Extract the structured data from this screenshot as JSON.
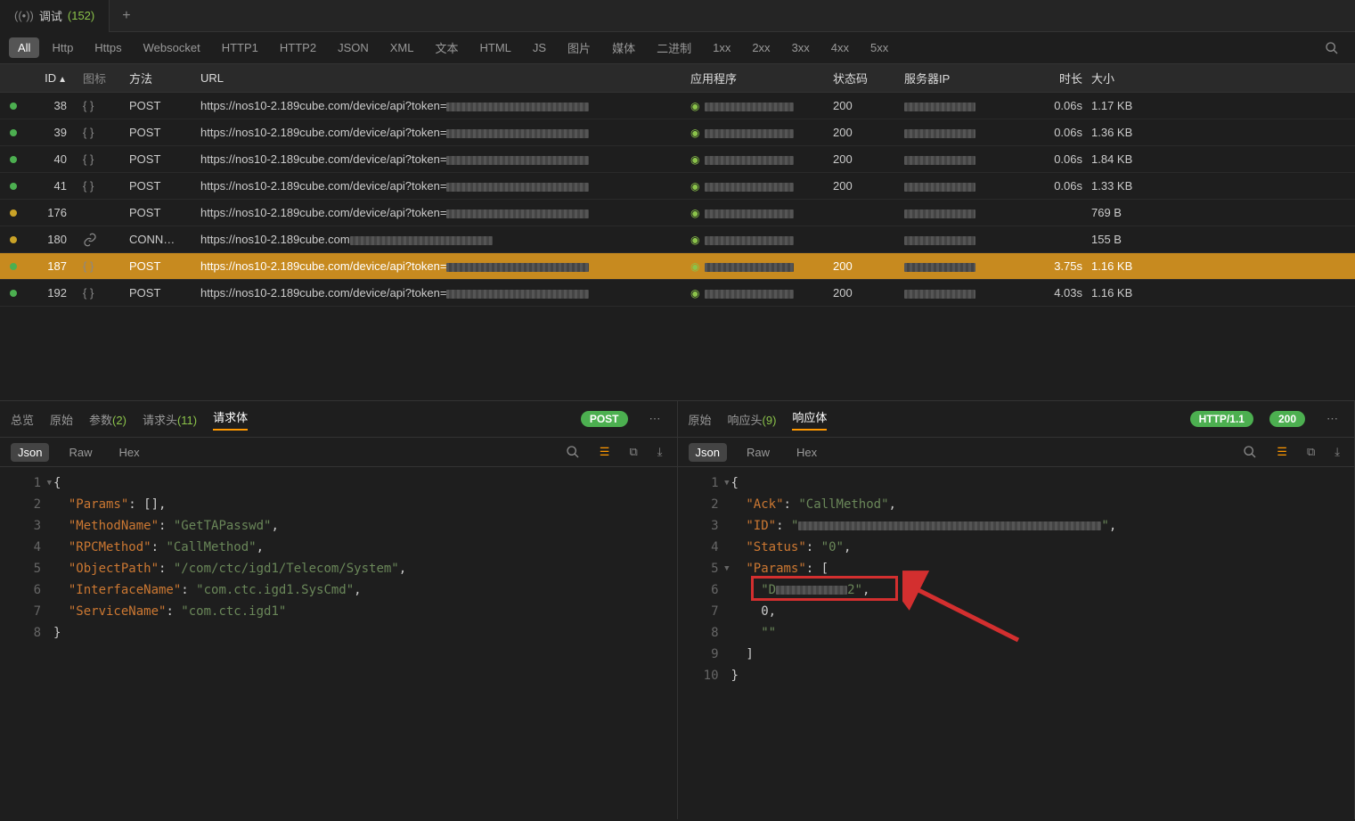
{
  "top_tab": {
    "label": "调试",
    "count": "(152)"
  },
  "filters": [
    "All",
    "Http",
    "Https",
    "Websocket",
    "HTTP1",
    "HTTP2",
    "JSON",
    "XML",
    "文本",
    "HTML",
    "JS",
    "图片",
    "媒体",
    "二进制",
    "1xx",
    "2xx",
    "3xx",
    "4xx",
    "5xx"
  ],
  "filter_active_index": 0,
  "columns": {
    "id": "ID",
    "icon": "图标",
    "method": "方法",
    "url": "URL",
    "app": "应用程序",
    "status": "状态码",
    "ip": "服务器IP",
    "dur": "时长",
    "size": "大小"
  },
  "rows": [
    {
      "dot": "g",
      "id": "38",
      "icon": "{ }",
      "method": "POST",
      "url": "https://nos10-2.189cube.com/device/api?token=",
      "status": "200",
      "dur": "0.06s",
      "size": "1.17 KB",
      "sel": false
    },
    {
      "dot": "g",
      "id": "39",
      "icon": "{ }",
      "method": "POST",
      "url": "https://nos10-2.189cube.com/device/api?token=",
      "status": "200",
      "dur": "0.06s",
      "size": "1.36 KB",
      "sel": false
    },
    {
      "dot": "g",
      "id": "40",
      "icon": "{ }",
      "method": "POST",
      "url": "https://nos10-2.189cube.com/device/api?token=",
      "status": "200",
      "dur": "0.06s",
      "size": "1.84 KB",
      "sel": false
    },
    {
      "dot": "g",
      "id": "41",
      "icon": "{ }",
      "method": "POST",
      "url": "https://nos10-2.189cube.com/device/api?token=",
      "status": "200",
      "dur": "0.06s",
      "size": "1.33 KB",
      "sel": false
    },
    {
      "dot": "y",
      "id": "176",
      "icon": "",
      "method": "POST",
      "url": "https://nos10-2.189cube.com/device/api?token=",
      "status": "",
      "dur": "",
      "size": "769 B",
      "sel": false
    },
    {
      "dot": "y",
      "id": "180",
      "icon": "link",
      "method": "CONN…",
      "url": "https://nos10-2.189cube.com",
      "status": "",
      "dur": "",
      "size": "155 B",
      "sel": false
    },
    {
      "dot": "g",
      "id": "187",
      "icon": "{ }",
      "method": "POST",
      "url": "https://nos10-2.189cube.com/device/api?token=",
      "status": "200",
      "dur": "3.75s",
      "size": "1.16 KB",
      "sel": true
    },
    {
      "dot": "g",
      "id": "192",
      "icon": "{ }",
      "method": "POST",
      "url": "https://nos10-2.189cube.com/device/api?token=",
      "status": "200",
      "dur": "4.03s",
      "size": "1.16 KB",
      "sel": false
    }
  ],
  "req_tabs": {
    "overview": "总览",
    "raw": "原始",
    "params": "参数",
    "params_cnt": "(2)",
    "headers": "请求头",
    "headers_cnt": "(11)",
    "body": "请求体"
  },
  "resp_tabs": {
    "raw": "原始",
    "headers": "响应头",
    "headers_cnt": "(9)",
    "body": "响应体"
  },
  "badges": {
    "post": "POST",
    "http": "HTTP/1.1",
    "code": "200"
  },
  "sub": {
    "json": "Json",
    "raw": "Raw",
    "hex": "Hex"
  },
  "req_code": {
    "l1": "{",
    "l2_k": "\"Params\"",
    "l2_v": "[]",
    "l3_k": "\"MethodName\"",
    "l3_v": "\"GetTAPasswd\"",
    "l4_k": "\"RPCMethod\"",
    "l4_v": "\"CallMethod\"",
    "l5_k": "\"ObjectPath\"",
    "l5_v": "\"/com/ctc/igd1/Telecom/System\"",
    "l6_k": "\"InterfaceName\"",
    "l6_v": "\"com.ctc.igd1.SysCmd\"",
    "l7_k": "\"ServiceName\"",
    "l7_v": "\"com.ctc.igd1\"",
    "l8": "}"
  },
  "resp_code": {
    "l1": "{",
    "l2_k": "\"Ack\"",
    "l2_v": "\"CallMethod\"",
    "l3_k": "\"ID\"",
    "l3_v_prefix": "\"",
    "l3_v_suffix": "\"",
    "l4_k": "\"Status\"",
    "l4_v": "\"0\"",
    "l5_k": "\"Params\"",
    "l5_v": "[",
    "l6_prefix": "\"D",
    "l6_suffix": "2\"",
    "l7": "0",
    "l8": "\"\"",
    "l9": "]",
    "l10": "}"
  },
  "line_nums": [
    "1",
    "2",
    "3",
    "4",
    "5",
    "6",
    "7",
    "8",
    "9",
    "10"
  ]
}
